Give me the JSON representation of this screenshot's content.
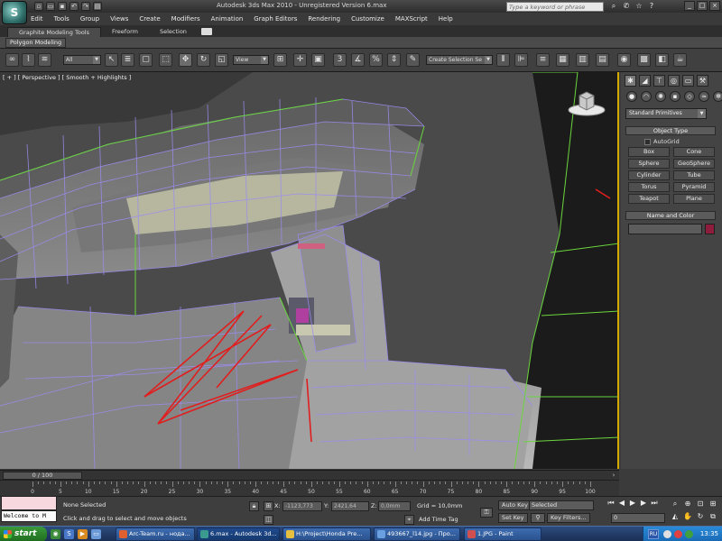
{
  "window": {
    "title": "Autodesk 3ds Max  2010    -  Unregistered Version    6.max",
    "help_search_placeholder": "Type a keyword or phrase"
  },
  "menu": [
    "Edit",
    "Tools",
    "Group",
    "Views",
    "Create",
    "Modifiers",
    "Animation",
    "Graph Editors",
    "Rendering",
    "Customize",
    "MAXScript",
    "Help"
  ],
  "ribbon": {
    "tabs": [
      "Graphite Modeling Tools",
      "Freeform",
      "Selection"
    ],
    "panel_label": "Polygon Modeling"
  },
  "toolbar": {
    "selection_filter": "All",
    "reference_coord": "View",
    "named_selection": "Create Selection Se"
  },
  "viewport": {
    "label": "[ + ] [ Perspective ] [ Smooth + Highlights ]"
  },
  "command_panel": {
    "category": "Standard Primitives",
    "object_type_header": "Object Type",
    "autogrid_label": "AutoGrid",
    "primitives": [
      "Box",
      "Cone",
      "Sphere",
      "GeoSphere",
      "Cylinder",
      "Tube",
      "Torus",
      "Pyramid",
      "Teapot",
      "Plane"
    ],
    "name_color_header": "Name and Color",
    "object_color": "#8e1c3c"
  },
  "timeline": {
    "slider_label": "0 / 100",
    "ticks": [
      "0",
      "5",
      "10",
      "15",
      "20",
      "25",
      "30",
      "35",
      "40",
      "45",
      "50",
      "55",
      "60",
      "65",
      "70",
      "75",
      "80",
      "85",
      "90",
      "95",
      "100"
    ]
  },
  "status": {
    "maxscript_output": "Welcome to M",
    "selection_status": "None Selected",
    "prompt": "Click and drag to select and move objects",
    "x_label": "X:",
    "x_value": "-1123,773",
    "y_label": "Y:",
    "y_value": "2421,64",
    "z_label": "Z:",
    "z_value": "0,0mm",
    "grid": "Grid = 10,0mm",
    "add_time_tag": "Add Time Tag",
    "auto_key": "Auto Key",
    "auto_key_mode": "Selected",
    "set_key": "Set Key",
    "key_filters": "Key Filters...",
    "current_frame": "0"
  },
  "taskbar": {
    "start_label": "start",
    "buttons": [
      "Arc-Team.ru - нода...",
      "6.max - Autodesk 3d...",
      "H:\\Project\\Honda Pre...",
      "493667_l14.jpg - Про...",
      "1.JPG - Paint"
    ],
    "language": "RU",
    "clock": "13:35"
  }
}
